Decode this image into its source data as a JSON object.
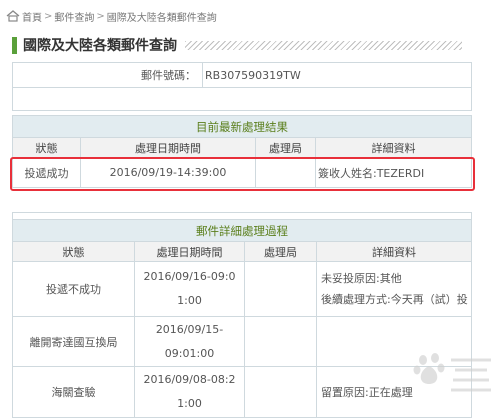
{
  "breadcrumb": {
    "items": [
      "首頁",
      "郵件查詢",
      "國際及大陸各類郵件查詢"
    ],
    "separator": ">"
  },
  "page": {
    "title": "國際及大陸各類郵件查詢",
    "accent_color": "#5aa03a"
  },
  "mail_number": {
    "label": "郵件號碼：",
    "value": "RB307590319TW"
  },
  "latest": {
    "section_title": "目前最新處理結果",
    "headers": [
      "狀態",
      "處理日期時間",
      "處理局",
      "詳細資料"
    ],
    "row": {
      "status": "投遞成功",
      "datetime": "2016/09/19-14:39:00",
      "office": "",
      "detail": "簽收人姓名:TEZERDI"
    }
  },
  "history": {
    "section_title": "郵件詳細處理過程",
    "headers": [
      "狀態",
      "處理日期時間",
      "處理局",
      "詳細資料"
    ],
    "rows": [
      {
        "status": "投遞不成功",
        "datetime_line1": "2016/09/16-09:0",
        "datetime_line2": "1:00",
        "office": "",
        "detail_line1": "未妥投原因:其他",
        "detail_line2": "後續處理方式:今天再（試）投"
      },
      {
        "status": "離開寄達國互換局",
        "datetime_line1": "2016/09/15-",
        "datetime_line2": "09:01:00",
        "office": "",
        "detail_line1": "",
        "detail_line2": ""
      },
      {
        "status": "海關查驗",
        "datetime_line1": "2016/09/08-08:2",
        "datetime_line2": "1:00",
        "office": "",
        "detail_line1": "留置原因:正在處理",
        "detail_line2": ""
      }
    ]
  },
  "highlight_color": "#e8303a",
  "icons": {
    "home": "home-icon",
    "watermark": "baidu-jingyan-watermark"
  }
}
